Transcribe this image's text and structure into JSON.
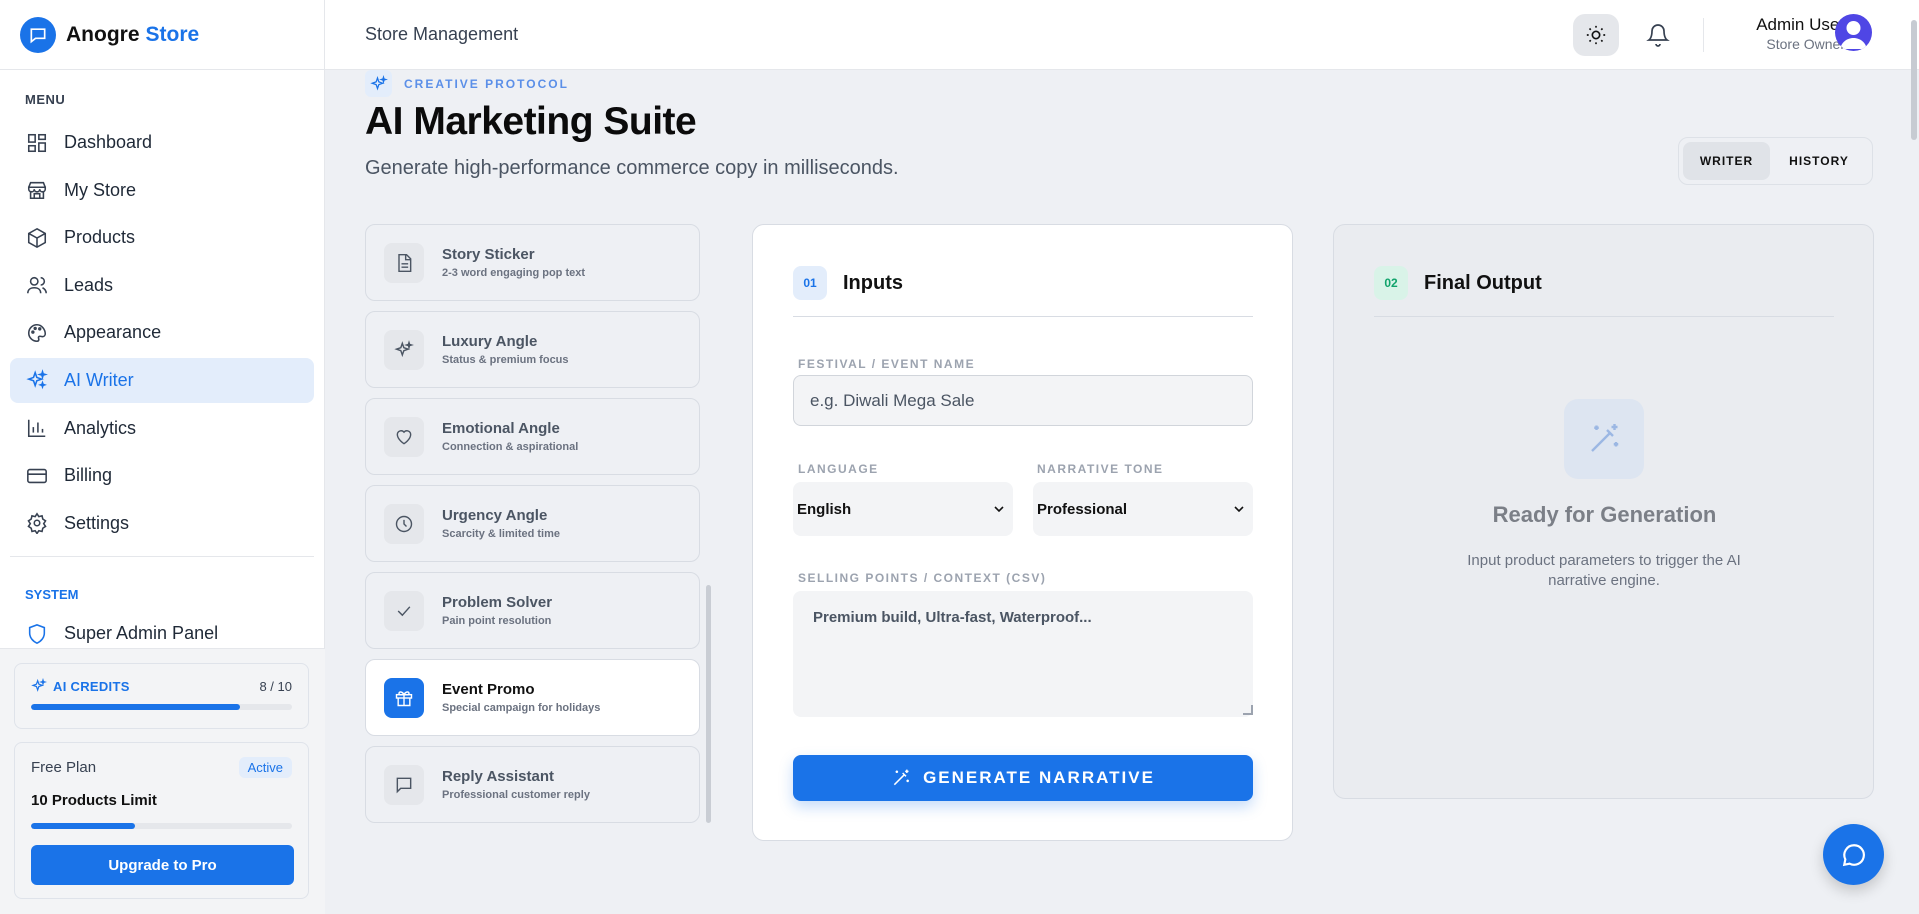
{
  "brand": {
    "name": "Anogre",
    "accent": "Store"
  },
  "sidebar": {
    "menu_label": "MENU",
    "items": [
      {
        "label": "Dashboard",
        "icon": "dashboard-icon"
      },
      {
        "label": "My Store",
        "icon": "store-icon"
      },
      {
        "label": "Products",
        "icon": "box-icon"
      },
      {
        "label": "Leads",
        "icon": "users-icon"
      },
      {
        "label": "Appearance",
        "icon": "palette-icon"
      },
      {
        "label": "AI Writer",
        "icon": "sparkles-icon",
        "active": true
      },
      {
        "label": "Analytics",
        "icon": "bar-chart-icon"
      },
      {
        "label": "Billing",
        "icon": "credit-card-icon"
      },
      {
        "label": "Settings",
        "icon": "gear-icon"
      }
    ],
    "system_label": "SYSTEM",
    "system_items": [
      {
        "label": "Super Admin Panel",
        "icon": "shield-icon"
      }
    ],
    "credits": {
      "title": "AI CREDITS",
      "count": "8 / 10",
      "used": 8,
      "total": 10
    },
    "plan": {
      "name": "Free Plan",
      "badge": "Active",
      "limit": "10 Products Limit",
      "progress": 0.4,
      "upgrade_label": "Upgrade to Pro"
    }
  },
  "header": {
    "title": "Store Management",
    "user_name": "Admin User",
    "user_role": "Store Owner"
  },
  "page": {
    "eyebrow": "CREATIVE PROTOCOL",
    "title": "AI Marketing Suite",
    "subtitle": "Generate high-performance commerce copy in milliseconds.",
    "tabs": [
      {
        "label": "WRITER",
        "active": true
      },
      {
        "label": "HISTORY",
        "active": false
      }
    ]
  },
  "types": [
    {
      "title": "Story Sticker",
      "sub": "2-3 word engaging pop text",
      "icon": "document-icon"
    },
    {
      "title": "Luxury Angle",
      "sub": "Status & premium focus",
      "icon": "sparkles-icon"
    },
    {
      "title": "Emotional Angle",
      "sub": "Connection & aspirational",
      "icon": "heart-icon"
    },
    {
      "title": "Urgency Angle",
      "sub": "Scarcity & limited time",
      "icon": "clock-icon"
    },
    {
      "title": "Problem Solver",
      "sub": "Pain point resolution",
      "icon": "check-icon"
    },
    {
      "title": "Event Promo",
      "sub": "Special campaign for holidays",
      "icon": "gift-icon",
      "active": true
    },
    {
      "title": "Reply Assistant",
      "sub": "Professional customer reply",
      "icon": "message-icon"
    }
  ],
  "inputs": {
    "badge": "01",
    "title": "Inputs",
    "event_label": "FESTIVAL / EVENT NAME",
    "event_placeholder": "e.g. Diwali Mega Sale",
    "language_label": "LANGUAGE",
    "language_value": "English",
    "tone_label": "NARRATIVE TONE",
    "tone_value": "Professional",
    "context_label": "SELLING POINTS / CONTEXT (CSV)",
    "context_placeholder": "Premium build, Ultra-fast, Waterproof...",
    "generate_label": "GENERATE NARRATIVE"
  },
  "output": {
    "badge": "02",
    "title": "Final Output",
    "ready_title": "Ready for Generation",
    "ready_sub": "Input product parameters to trigger the AI narrative engine."
  },
  "colors": {
    "accent": "#1a73e8",
    "active_bg": "#e3edfb",
    "success": "#10a36b"
  }
}
